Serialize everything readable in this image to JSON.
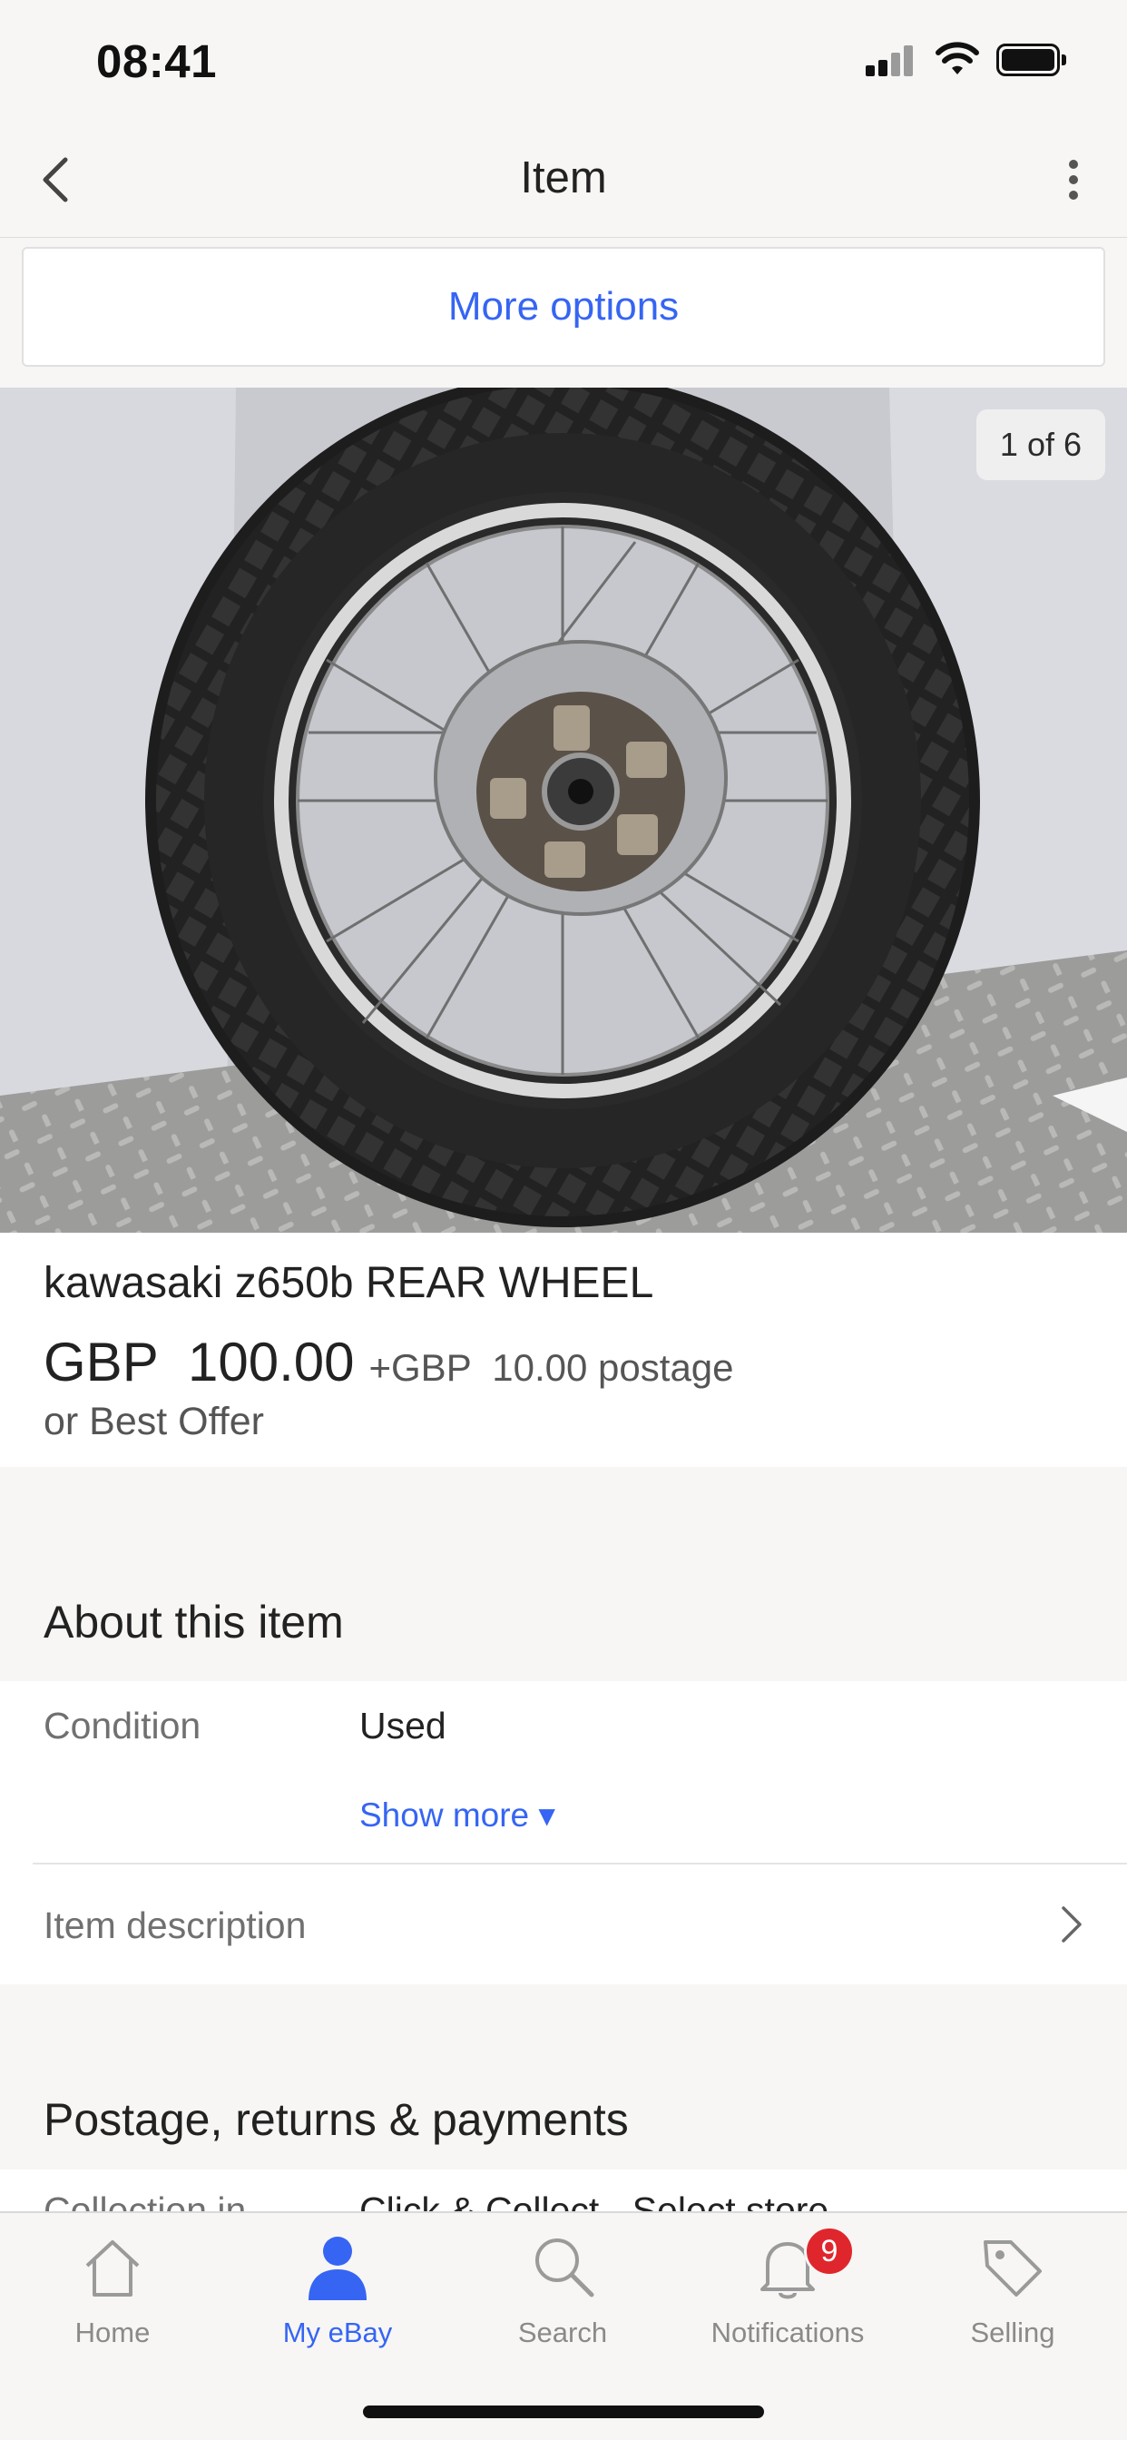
{
  "status_bar": {
    "time": "08:41"
  },
  "nav": {
    "title": "Item"
  },
  "more_options": {
    "label": "More options"
  },
  "image": {
    "counter": "1 of 6",
    "description": "rear motorcycle wheel with tyre"
  },
  "item": {
    "title": "kawasaki z650b REAR WHEEL",
    "price": "GBP  100.00",
    "postage": "+GBP  10.00 postage",
    "best_offer": "or Best Offer"
  },
  "about": {
    "heading": "About this item",
    "condition_label": "Condition",
    "condition_value": "Used",
    "show_more": "Show more ▾",
    "description_label": "Item description"
  },
  "postage_section": {
    "heading": "Postage, returns & payments",
    "collection_label": "Collection in",
    "collection_value": "Click & Collect - Select store"
  },
  "tabs": [
    {
      "label": "Home",
      "icon": "home-icon"
    },
    {
      "label": "My eBay",
      "icon": "person-icon",
      "active": true
    },
    {
      "label": "Search",
      "icon": "search-icon"
    },
    {
      "label": "Notifications",
      "icon": "bell-icon",
      "badge": "9"
    },
    {
      "label": "Selling",
      "icon": "tag-icon"
    }
  ],
  "colors": {
    "accent": "#3665f3",
    "badge": "#e0262d",
    "background": "#f7f6f4"
  }
}
